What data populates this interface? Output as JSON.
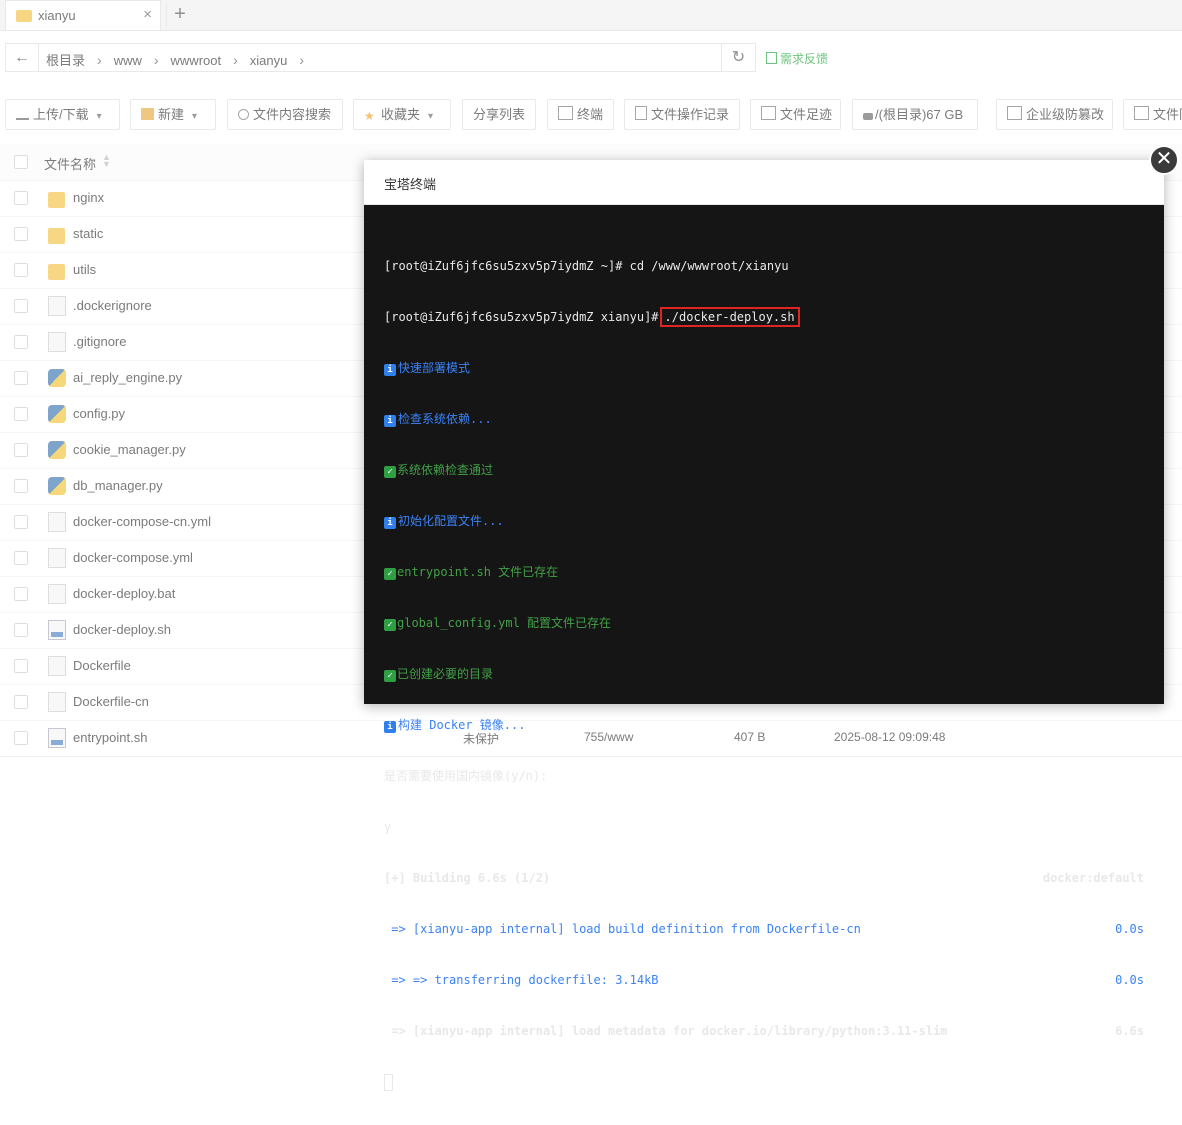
{
  "tab": {
    "title": "xianyu",
    "close": "×",
    "add": "+"
  },
  "address": {
    "back": "←",
    "crumbs": [
      "根目录",
      "www",
      "wwwroot",
      "xianyu"
    ],
    "refresh": "↻",
    "feedback": "需求反馈"
  },
  "toolbar": {
    "upload": "上传/下载",
    "new": "新建",
    "search_content": "文件内容搜索",
    "favorites": "收藏夹",
    "share_list": "分享列表",
    "terminal": "终端",
    "op_log": "文件操作记录",
    "footprint": "文件足迹",
    "disk": "/(根目录)67 GB",
    "tamper": "企业级防篡改",
    "file_sync": "文件同"
  },
  "table": {
    "col_name": "文件名称",
    "rows": [
      {
        "name": "nginx",
        "type": "folder"
      },
      {
        "name": "static",
        "type": "folder"
      },
      {
        "name": "utils",
        "type": "folder"
      },
      {
        "name": ".dockerignore",
        "type": "file"
      },
      {
        "name": ".gitignore",
        "type": "file"
      },
      {
        "name": "ai_reply_engine.py",
        "type": "py"
      },
      {
        "name": "config.py",
        "type": "py"
      },
      {
        "name": "cookie_manager.py",
        "type": "py"
      },
      {
        "name": "db_manager.py",
        "type": "py"
      },
      {
        "name": "docker-compose-cn.yml",
        "type": "file"
      },
      {
        "name": "docker-compose.yml",
        "type": "file"
      },
      {
        "name": "docker-deploy.bat",
        "type": "file"
      },
      {
        "name": "docker-deploy.sh",
        "type": "sh"
      },
      {
        "name": "Dockerfile",
        "type": "file"
      },
      {
        "name": "Dockerfile-cn",
        "type": "file"
      },
      {
        "name": "entrypoint.sh",
        "type": "sh",
        "protect": "未保护",
        "perm": "755/www",
        "size": "407 B",
        "mtime": "2025-08-12 09:09:48"
      }
    ]
  },
  "modal": {
    "title": "宝塔终端",
    "close": "✕",
    "lines": {
      "l1": "[root@iZuf6jfc6su5zxv5p7iydmZ ~]# cd /www/wwwroot/xianyu",
      "l2_prompt": "[root@iZuf6jfc6su5zxv5p7iydmZ xianyu]#",
      "l2_cmd": "./docker-deploy.sh",
      "l3": "快速部署模式",
      "l4": "检查系统依赖...",
      "l5": "系统依赖检查通过",
      "l6": "初始化配置文件...",
      "l7": "entrypoint.sh 文件已存在",
      "l8": "global_config.yml 配置文件已存在",
      "l9": "已创建必要的目录",
      "l10": "构建 Docker 镜像...",
      "l11": "是否需要使用国内镜像(y/n):",
      "l12": "y",
      "l13": "[+] Building 6.6s (1/2)",
      "l13_r": "docker:default",
      "l14": " => [xianyu-app internal] load build definition from Dockerfile-cn",
      "l14_r": "0.0s",
      "l15": " => => transferring dockerfile: 3.14kB",
      "l15_r": "0.0s",
      "l16": " => [xianyu-app internal] load metadata for docker.io/library/python:3.11-slim",
      "l16_r": "6.6s"
    }
  }
}
